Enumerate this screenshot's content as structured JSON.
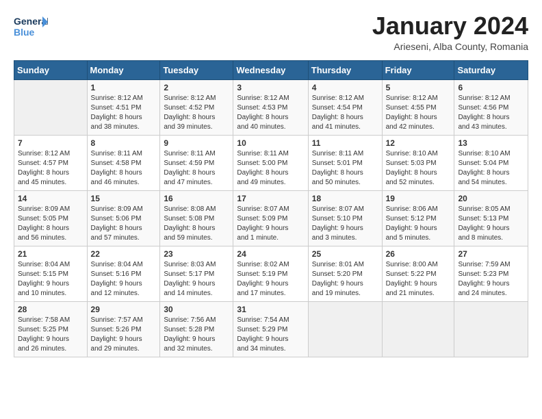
{
  "header": {
    "logo_line1": "General",
    "logo_line2": "Blue",
    "title": "January 2024",
    "subtitle": "Arieseni, Alba County, Romania"
  },
  "days_of_week": [
    "Sunday",
    "Monday",
    "Tuesday",
    "Wednesday",
    "Thursday",
    "Friday",
    "Saturday"
  ],
  "weeks": [
    [
      {
        "num": "",
        "info": ""
      },
      {
        "num": "1",
        "info": "Sunrise: 8:12 AM\nSunset: 4:51 PM\nDaylight: 8 hours\nand 38 minutes."
      },
      {
        "num": "2",
        "info": "Sunrise: 8:12 AM\nSunset: 4:52 PM\nDaylight: 8 hours\nand 39 minutes."
      },
      {
        "num": "3",
        "info": "Sunrise: 8:12 AM\nSunset: 4:53 PM\nDaylight: 8 hours\nand 40 minutes."
      },
      {
        "num": "4",
        "info": "Sunrise: 8:12 AM\nSunset: 4:54 PM\nDaylight: 8 hours\nand 41 minutes."
      },
      {
        "num": "5",
        "info": "Sunrise: 8:12 AM\nSunset: 4:55 PM\nDaylight: 8 hours\nand 42 minutes."
      },
      {
        "num": "6",
        "info": "Sunrise: 8:12 AM\nSunset: 4:56 PM\nDaylight: 8 hours\nand 43 minutes."
      }
    ],
    [
      {
        "num": "7",
        "info": "Sunrise: 8:12 AM\nSunset: 4:57 PM\nDaylight: 8 hours\nand 45 minutes."
      },
      {
        "num": "8",
        "info": "Sunrise: 8:11 AM\nSunset: 4:58 PM\nDaylight: 8 hours\nand 46 minutes."
      },
      {
        "num": "9",
        "info": "Sunrise: 8:11 AM\nSunset: 4:59 PM\nDaylight: 8 hours\nand 47 minutes."
      },
      {
        "num": "10",
        "info": "Sunrise: 8:11 AM\nSunset: 5:00 PM\nDaylight: 8 hours\nand 49 minutes."
      },
      {
        "num": "11",
        "info": "Sunrise: 8:11 AM\nSunset: 5:01 PM\nDaylight: 8 hours\nand 50 minutes."
      },
      {
        "num": "12",
        "info": "Sunrise: 8:10 AM\nSunset: 5:03 PM\nDaylight: 8 hours\nand 52 minutes."
      },
      {
        "num": "13",
        "info": "Sunrise: 8:10 AM\nSunset: 5:04 PM\nDaylight: 8 hours\nand 54 minutes."
      }
    ],
    [
      {
        "num": "14",
        "info": "Sunrise: 8:09 AM\nSunset: 5:05 PM\nDaylight: 8 hours\nand 56 minutes."
      },
      {
        "num": "15",
        "info": "Sunrise: 8:09 AM\nSunset: 5:06 PM\nDaylight: 8 hours\nand 57 minutes."
      },
      {
        "num": "16",
        "info": "Sunrise: 8:08 AM\nSunset: 5:08 PM\nDaylight: 8 hours\nand 59 minutes."
      },
      {
        "num": "17",
        "info": "Sunrise: 8:07 AM\nSunset: 5:09 PM\nDaylight: 9 hours\nand 1 minute."
      },
      {
        "num": "18",
        "info": "Sunrise: 8:07 AM\nSunset: 5:10 PM\nDaylight: 9 hours\nand 3 minutes."
      },
      {
        "num": "19",
        "info": "Sunrise: 8:06 AM\nSunset: 5:12 PM\nDaylight: 9 hours\nand 5 minutes."
      },
      {
        "num": "20",
        "info": "Sunrise: 8:05 AM\nSunset: 5:13 PM\nDaylight: 9 hours\nand 8 minutes."
      }
    ],
    [
      {
        "num": "21",
        "info": "Sunrise: 8:04 AM\nSunset: 5:15 PM\nDaylight: 9 hours\nand 10 minutes."
      },
      {
        "num": "22",
        "info": "Sunrise: 8:04 AM\nSunset: 5:16 PM\nDaylight: 9 hours\nand 12 minutes."
      },
      {
        "num": "23",
        "info": "Sunrise: 8:03 AM\nSunset: 5:17 PM\nDaylight: 9 hours\nand 14 minutes."
      },
      {
        "num": "24",
        "info": "Sunrise: 8:02 AM\nSunset: 5:19 PM\nDaylight: 9 hours\nand 17 minutes."
      },
      {
        "num": "25",
        "info": "Sunrise: 8:01 AM\nSunset: 5:20 PM\nDaylight: 9 hours\nand 19 minutes."
      },
      {
        "num": "26",
        "info": "Sunrise: 8:00 AM\nSunset: 5:22 PM\nDaylight: 9 hours\nand 21 minutes."
      },
      {
        "num": "27",
        "info": "Sunrise: 7:59 AM\nSunset: 5:23 PM\nDaylight: 9 hours\nand 24 minutes."
      }
    ],
    [
      {
        "num": "28",
        "info": "Sunrise: 7:58 AM\nSunset: 5:25 PM\nDaylight: 9 hours\nand 26 minutes."
      },
      {
        "num": "29",
        "info": "Sunrise: 7:57 AM\nSunset: 5:26 PM\nDaylight: 9 hours\nand 29 minutes."
      },
      {
        "num": "30",
        "info": "Sunrise: 7:56 AM\nSunset: 5:28 PM\nDaylight: 9 hours\nand 32 minutes."
      },
      {
        "num": "31",
        "info": "Sunrise: 7:54 AM\nSunset: 5:29 PM\nDaylight: 9 hours\nand 34 minutes."
      },
      {
        "num": "",
        "info": ""
      },
      {
        "num": "",
        "info": ""
      },
      {
        "num": "",
        "info": ""
      }
    ]
  ]
}
